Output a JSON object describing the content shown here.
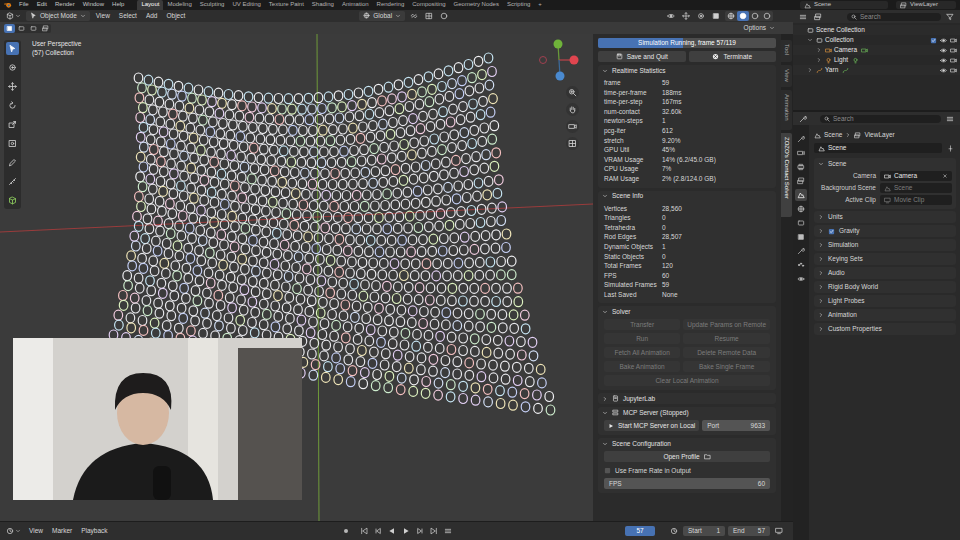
{
  "topbar": {
    "menus": [
      "File",
      "Edit",
      "Render",
      "Window",
      "Help"
    ],
    "workspaces": [
      {
        "label": "Layout",
        "selected": true
      },
      {
        "label": "Modeling",
        "selected": false
      },
      {
        "label": "Sculpting",
        "selected": false
      },
      {
        "label": "UV Editing",
        "selected": false
      },
      {
        "label": "Texture Paint",
        "selected": false
      },
      {
        "label": "Shading",
        "selected": false
      },
      {
        "label": "Animation",
        "selected": false
      },
      {
        "label": "Rendering",
        "selected": false
      },
      {
        "label": "Compositing",
        "selected": false
      },
      {
        "label": "Geometry Nodes",
        "selected": false
      },
      {
        "label": "Scripting",
        "selected": false
      }
    ],
    "add_workspace": "+",
    "scene": "Scene",
    "view_layer": "ViewLayer"
  },
  "viewport": {
    "mode": "Object Mode",
    "menus": [
      "View",
      "Select",
      "Add",
      "Object"
    ],
    "orientation": "Global",
    "options": "Options",
    "overlay": [
      "User Perspective",
      "(57) Collection"
    ],
    "tools": [
      {
        "selected": true
      },
      {
        "selected": false
      },
      {
        "selected": false
      },
      {
        "selected": false
      },
      {
        "selected": false
      },
      {
        "selected": false
      },
      {
        "selected": false
      },
      {
        "selected": false
      },
      {
        "selected": false
      }
    ]
  },
  "sidebar_tabs": [
    {
      "label": "Tool",
      "selected": false
    },
    {
      "label": "View",
      "selected": false
    },
    {
      "label": "Animation",
      "selected": false
    },
    {
      "label": "ZOZO's Contact Solver",
      "selected": true
    }
  ],
  "solver": {
    "progress": {
      "label": "Simulation Running, frame 57/119",
      "level": 0.48
    },
    "actions": [
      "Save and Quit",
      "Terminate"
    ],
    "stats": {
      "title": "Realtime Statistics",
      "expanded": true,
      "rows": [
        {
          "label": "frame",
          "value": "59"
        },
        {
          "label": "time-per-frame",
          "value": "188ms"
        },
        {
          "label": "time-per-step",
          "value": "167ms"
        },
        {
          "label": "num-contact",
          "value": "32.60k"
        },
        {
          "label": "newton-steps",
          "value": "1"
        },
        {
          "label": "pcg-iter",
          "value": "612"
        },
        {
          "label": "stretch",
          "value": "9.20%"
        },
        {
          "label": "GPU Util",
          "value": "45%"
        },
        {
          "label": "VRAM Usage",
          "value": "14% (6.2/45.0 GB)"
        },
        {
          "label": "CPU Usage",
          "value": "7%"
        },
        {
          "label": "RAM Usage",
          "value": "2% (2.8/124.0 GB)"
        }
      ]
    },
    "scene_info": {
      "title": "Scene Info",
      "expanded": true,
      "rows": [
        {
          "label": "Vertices",
          "value": "28,560"
        },
        {
          "label": "Triangles",
          "value": "0"
        },
        {
          "label": "Tetrahedra",
          "value": "0"
        },
        {
          "label": "Rod Edges",
          "value": "28,507"
        },
        {
          "label": "Dynamic Objects",
          "value": "1"
        },
        {
          "label": "Static Objects",
          "value": "0"
        },
        {
          "label": "Total Frames",
          "value": "120"
        },
        {
          "label": "FPS",
          "value": "60"
        },
        {
          "label": "Simulated Frames",
          "value": "59"
        },
        {
          "label": "Last Saved",
          "value": "None"
        }
      ]
    },
    "controls": {
      "title": "Solver",
      "expanded": true,
      "buttons": [
        {
          "label": "Transfer",
          "disabled": true
        },
        {
          "label": "Update Params on Remote",
          "disabled": true
        },
        {
          "label": "Run",
          "disabled": true
        },
        {
          "label": "Resume",
          "disabled": true
        },
        {
          "label": "Fetch All Animation",
          "disabled": true
        },
        {
          "label": "Delete Remote Data",
          "disabled": true
        },
        {
          "label": "Bake Animation",
          "disabled": true
        },
        {
          "label": "Bake Single Frame",
          "disabled": true
        },
        {
          "label": "Clear Local Animation",
          "disabled": true
        }
      ]
    },
    "jupyter": {
      "title": "JupyterLab",
      "expanded": false
    },
    "mcp": {
      "title": "MCP Server (Stopped)",
      "expanded": true,
      "button": "Start MCP Server on Local",
      "port_label": "Port",
      "port": "9633"
    },
    "config": {
      "title": "Scene Configuration",
      "expanded": true,
      "open_profile": "Open Profile",
      "use_frame_rate": {
        "label": "Use Frame Rate in Output",
        "checked": false
      },
      "fps": {
        "label": "FPS",
        "value": "60"
      }
    }
  },
  "outliner": {
    "search": "Search",
    "items": [
      {
        "label": "Scene Collection",
        "depth": 0,
        "kind": "root",
        "expanded": true
      },
      {
        "label": "Collection",
        "depth": 1,
        "kind": "collection",
        "expanded": true
      },
      {
        "label": "Camera",
        "depth": 2,
        "kind": "camera",
        "expanded": false
      },
      {
        "label": "Light",
        "depth": 2,
        "kind": "light",
        "expanded": false
      },
      {
        "label": "Yarn",
        "depth": 1,
        "kind": "curve",
        "expanded": false
      }
    ]
  },
  "properties": {
    "search": "Search",
    "tabs": [
      {
        "selected": false
      },
      {
        "selected": false
      },
      {
        "selected": false
      },
      {
        "selected": false
      },
      {
        "selected": true
      },
      {
        "selected": false
      },
      {
        "selected": false
      },
      {
        "selected": false
      },
      {
        "selected": false
      },
      {
        "selected": false
      },
      {
        "selected": false
      }
    ],
    "breadcrumb": [
      "Scene",
      "ViewLayer"
    ],
    "scene_name": "Scene",
    "panel": {
      "title": "Scene",
      "expanded": true,
      "fields": [
        {
          "label": "Camera",
          "value": "Camera",
          "placeholder": false
        },
        {
          "label": "Background Scene",
          "value": "Scene",
          "placeholder": true
        },
        {
          "label": "Active Clip",
          "value": "Movie Clip",
          "placeholder": true
        }
      ]
    },
    "collapsed": [
      {
        "label": "Units",
        "kind": "plain"
      },
      {
        "label": "Gravity",
        "kind": "toggle",
        "checked": true
      },
      {
        "label": "Simulation",
        "kind": "plain"
      },
      {
        "label": "Keying Sets",
        "kind": "plain"
      },
      {
        "label": "Audio",
        "kind": "plain"
      },
      {
        "label": "Rigid Body World",
        "kind": "plain"
      },
      {
        "label": "Light Probes",
        "kind": "plain"
      },
      {
        "label": "Animation",
        "kind": "plain"
      },
      {
        "label": "Custom Properties",
        "kind": "plain"
      }
    ]
  },
  "timeline": {
    "menus": [
      "View",
      "Marker",
      "Playback"
    ],
    "current": "57",
    "start_label": "Start",
    "start": "1",
    "end_label": "End",
    "end": "57"
  }
}
